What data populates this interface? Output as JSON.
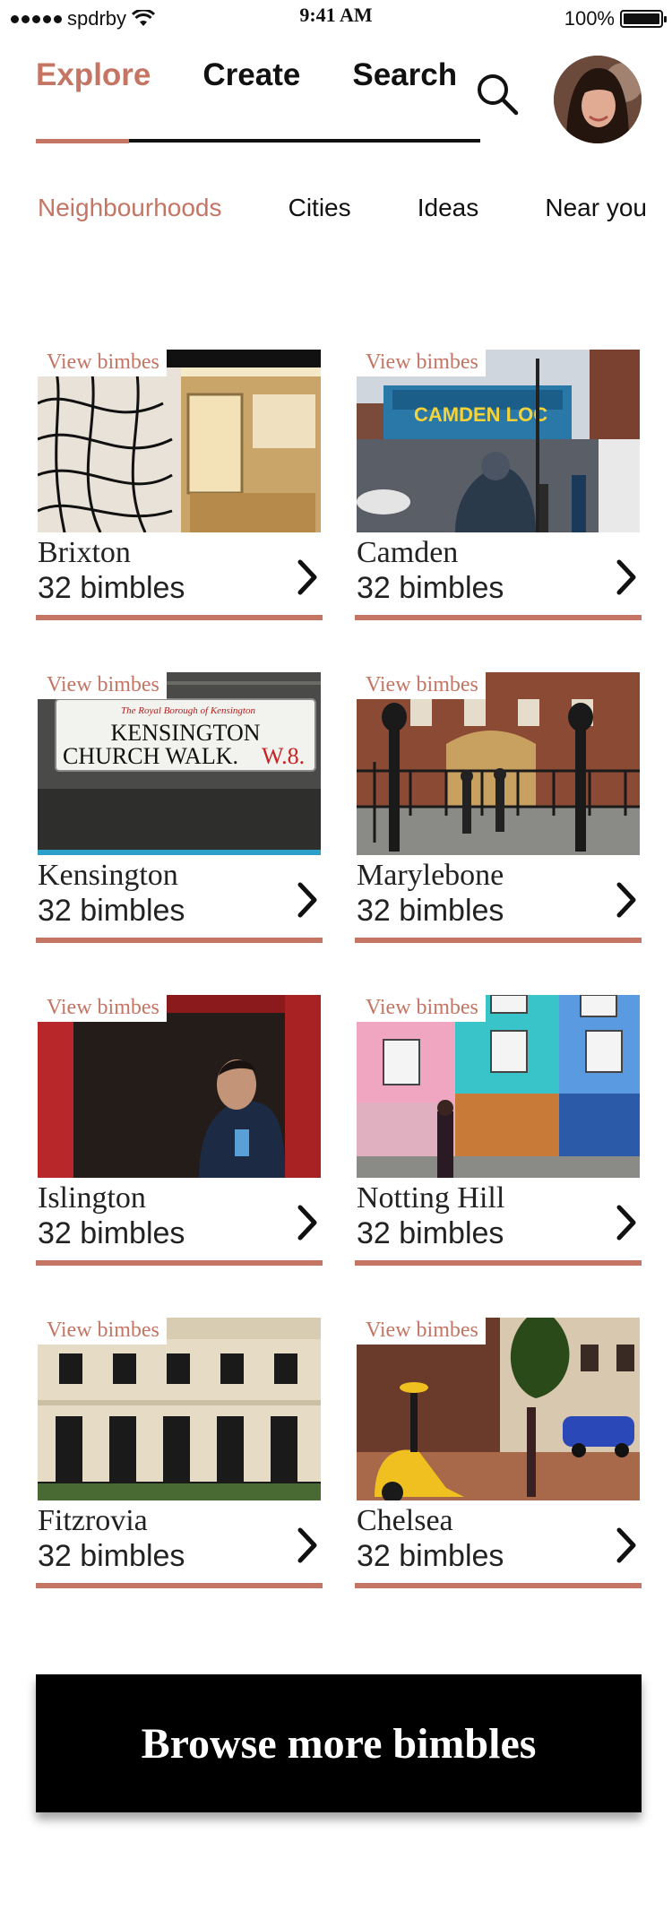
{
  "status_bar": {
    "carrier": "spdrby",
    "time": "9:41 AM",
    "battery": "100%"
  },
  "nav": {
    "tabs": [
      "Explore",
      "Create",
      "Search"
    ],
    "active_tab": "Explore"
  },
  "subnav": {
    "items": [
      "Neighbourhoods",
      "Cities",
      "Ideas",
      "Near you"
    ],
    "active_item": "Neighbourhoods"
  },
  "cards": [
    {
      "badge": "View bimbes",
      "name": "Brixton",
      "count": "32 bimbles"
    },
    {
      "badge": "View bimbes",
      "name": "Camden",
      "count": "32 bimbles"
    },
    {
      "badge": "View bimbes",
      "name": "Kensington",
      "count": "32 bimbles"
    },
    {
      "badge": "View bimbes",
      "name": "Marylebone",
      "count": "32 bimbles"
    },
    {
      "badge": "View bimbes",
      "name": "Islington",
      "count": "32 bimbles"
    },
    {
      "badge": "View bimbes",
      "name": "Notting Hill",
      "count": "32 bimbles"
    },
    {
      "badge": "View bimbes",
      "name": "Fitzrovia",
      "count": "32 bimbles"
    },
    {
      "badge": "View bimbes",
      "name": "Chelsea",
      "count": "32 bimbles"
    }
  ],
  "photo_text": {
    "camden_sign": "CAMDEN LOC",
    "kensington_sign_top": "The Royal Borough of Kensington",
    "kensington_sign_line1": "KENSINGTON",
    "kensington_sign_line2": "CHURCH WALK.",
    "kensington_sign_code": "W.8."
  },
  "cta": {
    "label": "Browse more bimbles"
  },
  "colors": {
    "accent": "#c47564",
    "text": "#111111",
    "cta_bg": "#000000"
  },
  "icons": [
    "signal-dots-icon",
    "wifi-icon",
    "battery-icon",
    "search-icon",
    "chevron-right-icon"
  ]
}
